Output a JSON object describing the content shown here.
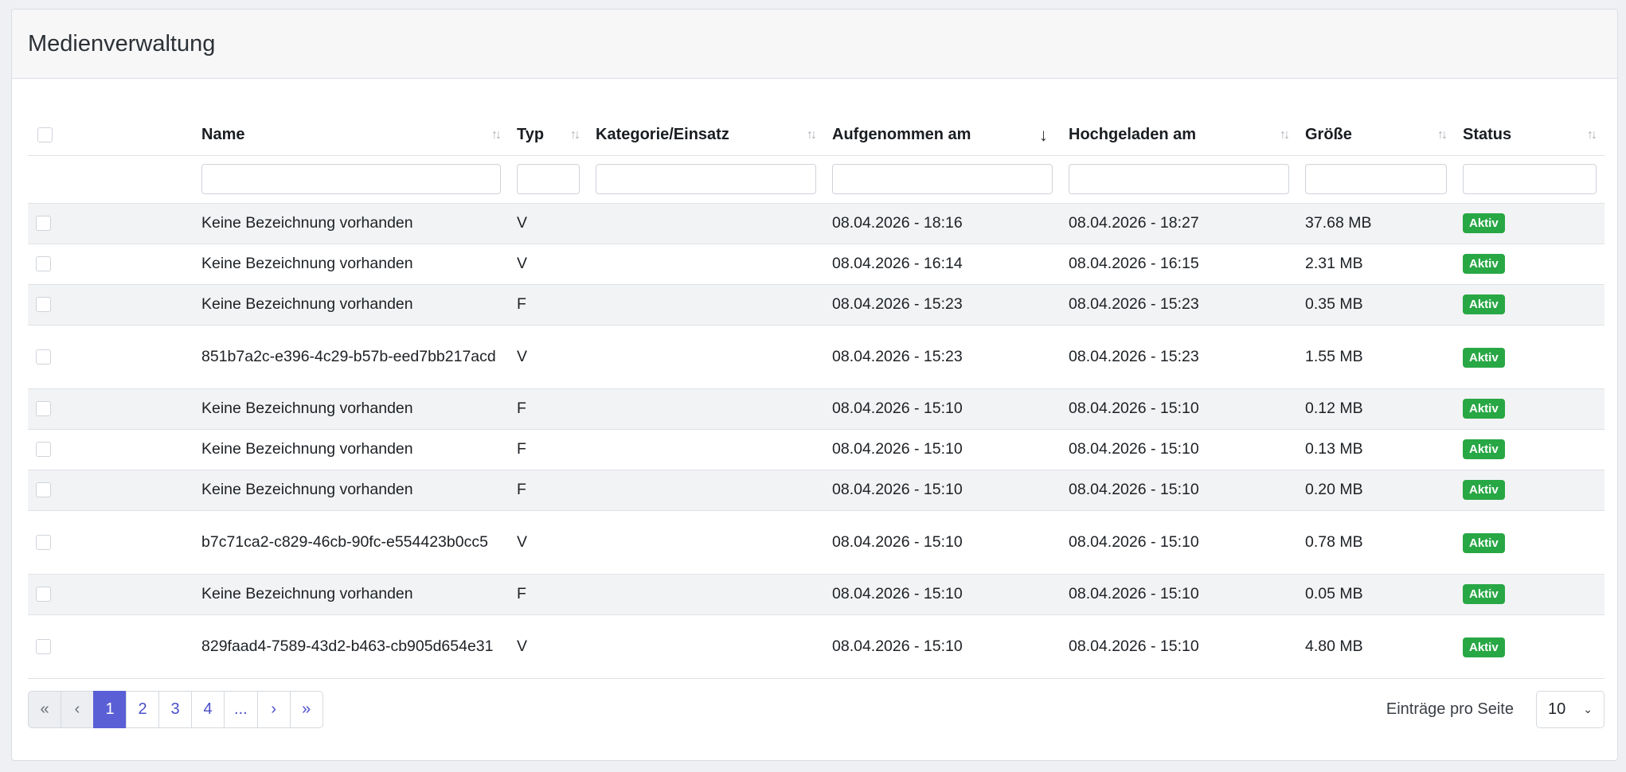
{
  "page": {
    "title": "Medienverwaltung"
  },
  "table": {
    "headers": {
      "name": "Name",
      "typ": "Typ",
      "kategorie": "Kategorie/Einsatz",
      "aufgenommen": "Aufgenommen am",
      "hochgeladen": "Hochgeladen am",
      "groesse": "Größe",
      "status": "Status"
    },
    "sort": {
      "icon_inactive": "↑↓",
      "icon_active": "↓",
      "active_column": "aufgenommen"
    },
    "rows": [
      {
        "name": "Keine Bezeichnung vorhanden",
        "typ": "V",
        "kategorie": "",
        "aufgenommen": "08.04.2026 - 18:16",
        "hochgeladen": "08.04.2026 - 18:27",
        "groesse": "37.68 MB",
        "status": "Aktiv"
      },
      {
        "name": "Keine Bezeichnung vorhanden",
        "typ": "V",
        "kategorie": "",
        "aufgenommen": "08.04.2026 - 16:14",
        "hochgeladen": "08.04.2026 - 16:15",
        "groesse": "2.31 MB",
        "status": "Aktiv"
      },
      {
        "name": "Keine Bezeichnung vorhanden",
        "typ": "F",
        "kategorie": "",
        "aufgenommen": "08.04.2026 - 15:23",
        "hochgeladen": "08.04.2026 - 15:23",
        "groesse": "0.35 MB",
        "status": "Aktiv"
      },
      {
        "name": "851b7a2c-e396-4c29-b57b-eed7bb217acd",
        "typ": "V",
        "kategorie": "",
        "aufgenommen": "08.04.2026 - 15:23",
        "hochgeladen": "08.04.2026 - 15:23",
        "groesse": "1.55 MB",
        "status": "Aktiv"
      },
      {
        "name": "Keine Bezeichnung vorhanden",
        "typ": "F",
        "kategorie": "",
        "aufgenommen": "08.04.2026 - 15:10",
        "hochgeladen": "08.04.2026 - 15:10",
        "groesse": "0.12 MB",
        "status": "Aktiv"
      },
      {
        "name": "Keine Bezeichnung vorhanden",
        "typ": "F",
        "kategorie": "",
        "aufgenommen": "08.04.2026 - 15:10",
        "hochgeladen": "08.04.2026 - 15:10",
        "groesse": "0.13 MB",
        "status": "Aktiv"
      },
      {
        "name": "Keine Bezeichnung vorhanden",
        "typ": "F",
        "kategorie": "",
        "aufgenommen": "08.04.2026 - 15:10",
        "hochgeladen": "08.04.2026 - 15:10",
        "groesse": "0.20 MB",
        "status": "Aktiv"
      },
      {
        "name": "b7c71ca2-c829-46cb-90fc-e554423b0cc5",
        "typ": "V",
        "kategorie": "",
        "aufgenommen": "08.04.2026 - 15:10",
        "hochgeladen": "08.04.2026 - 15:10",
        "groesse": "0.78 MB",
        "status": "Aktiv"
      },
      {
        "name": "Keine Bezeichnung vorhanden",
        "typ": "F",
        "kategorie": "",
        "aufgenommen": "08.04.2026 - 15:10",
        "hochgeladen": "08.04.2026 - 15:10",
        "groesse": "0.05 MB",
        "status": "Aktiv"
      },
      {
        "name": "829faad4-7589-43d2-b463-cb905d654e31",
        "typ": "V",
        "kategorie": "",
        "aufgenommen": "08.04.2026 - 15:10",
        "hochgeladen": "08.04.2026 - 15:10",
        "groesse": "4.80 MB",
        "status": "Aktiv"
      }
    ]
  },
  "pagination": {
    "first": "«",
    "prev": "‹",
    "pages": [
      "1",
      "2",
      "3",
      "4"
    ],
    "ellipsis": "...",
    "next": "›",
    "last": "»",
    "current": "1"
  },
  "per_page": {
    "label": "Einträge pro Seite",
    "value": "10",
    "chevron": "⌄"
  },
  "colors": {
    "accent": "#5a5fd6",
    "status_active": "#28a745",
    "stripe": "#f2f3f4"
  }
}
